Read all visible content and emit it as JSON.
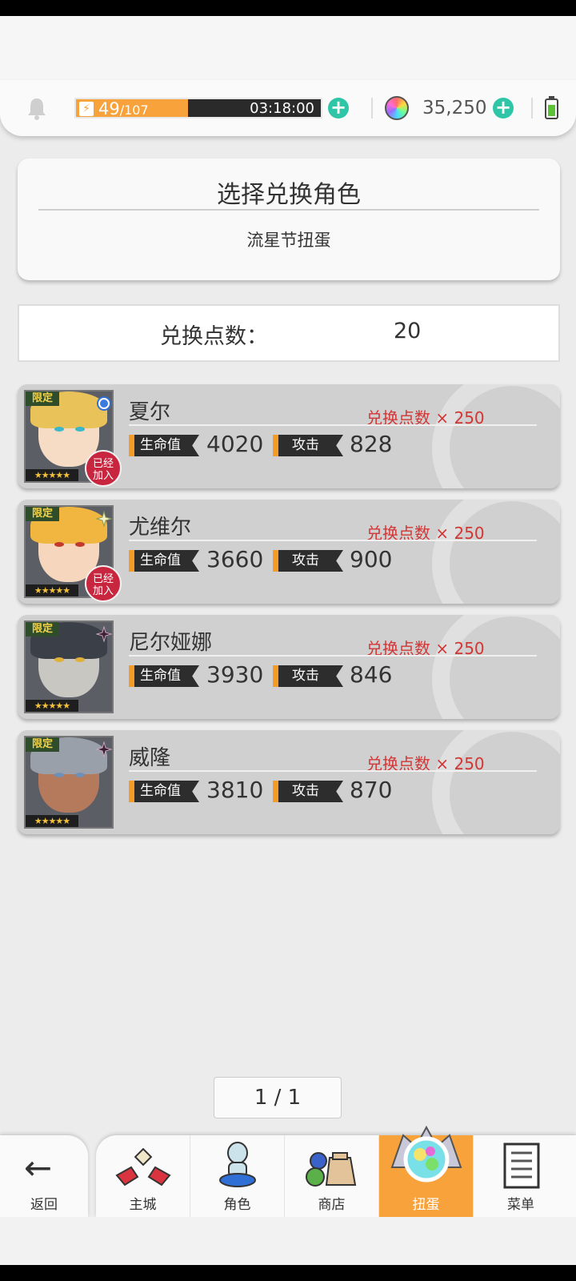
{
  "hud": {
    "energy_current": "49",
    "energy_max": "/107",
    "energy_fill_fraction": 0.458,
    "timer": "03:18:00",
    "gems": "35,250"
  },
  "header": {
    "title": "选择兑换角色",
    "subtitle": "流星节扭蛋"
  },
  "points": {
    "label": "兑换点数：",
    "value": "20"
  },
  "characters": [
    {
      "name": "夏尔",
      "cost": "兑换点数 × 250",
      "hp_label": "生命值",
      "hp": "4020",
      "atk_label": "攻击",
      "atk": "828",
      "limited": "限定",
      "stars": "★★★★★",
      "joined": "已经加入",
      "badge": "blue-circle-icon",
      "hair": "#e9c35a",
      "skin": "#f6dcc4",
      "eye": "#3bb7c9"
    },
    {
      "name": "尤维尔",
      "cost": "兑换点数 × 250",
      "hp_label": "生命值",
      "hp": "3660",
      "atk_label": "攻击",
      "atk": "900",
      "limited": "限定",
      "stars": "★★★★★",
      "joined": "已经加入",
      "badge": "sparkle-icon",
      "hair": "#f0b640",
      "skin": "#f6d7bd",
      "eye": "#c23a2c"
    },
    {
      "name": "尼尔娅娜",
      "cost": "兑换点数 × 250",
      "hp_label": "生命值",
      "hp": "3930",
      "atk_label": "攻击",
      "atk": "846",
      "limited": "限定",
      "stars": "★★★★★",
      "joined": "",
      "badge": "dark-star-icon",
      "hair": "#3a3f48",
      "skin": "#c9c7c2",
      "eye": "#e0b13a"
    },
    {
      "name": "威隆",
      "cost": "兑换点数 × 250",
      "hp_label": "生命值",
      "hp": "3810",
      "atk_label": "攻击",
      "atk": "870",
      "limited": "限定",
      "stars": "★★★★★",
      "joined": "",
      "badge": "dark-star-icon",
      "hair": "#9aa0aa",
      "skin": "#b57a5c",
      "eye": "#6f8fb6"
    }
  ],
  "pager": "1 / 1",
  "nav": {
    "back": "返回",
    "items": [
      {
        "label": "主城",
        "icon": "castle-icon"
      },
      {
        "label": "角色",
        "icon": "character-icon"
      },
      {
        "label": "商店",
        "icon": "shop-icon"
      },
      {
        "label": "扭蛋",
        "icon": "gacha-icon",
        "active": true
      },
      {
        "label": "菜单",
        "icon": "menu-list-icon"
      }
    ]
  }
}
